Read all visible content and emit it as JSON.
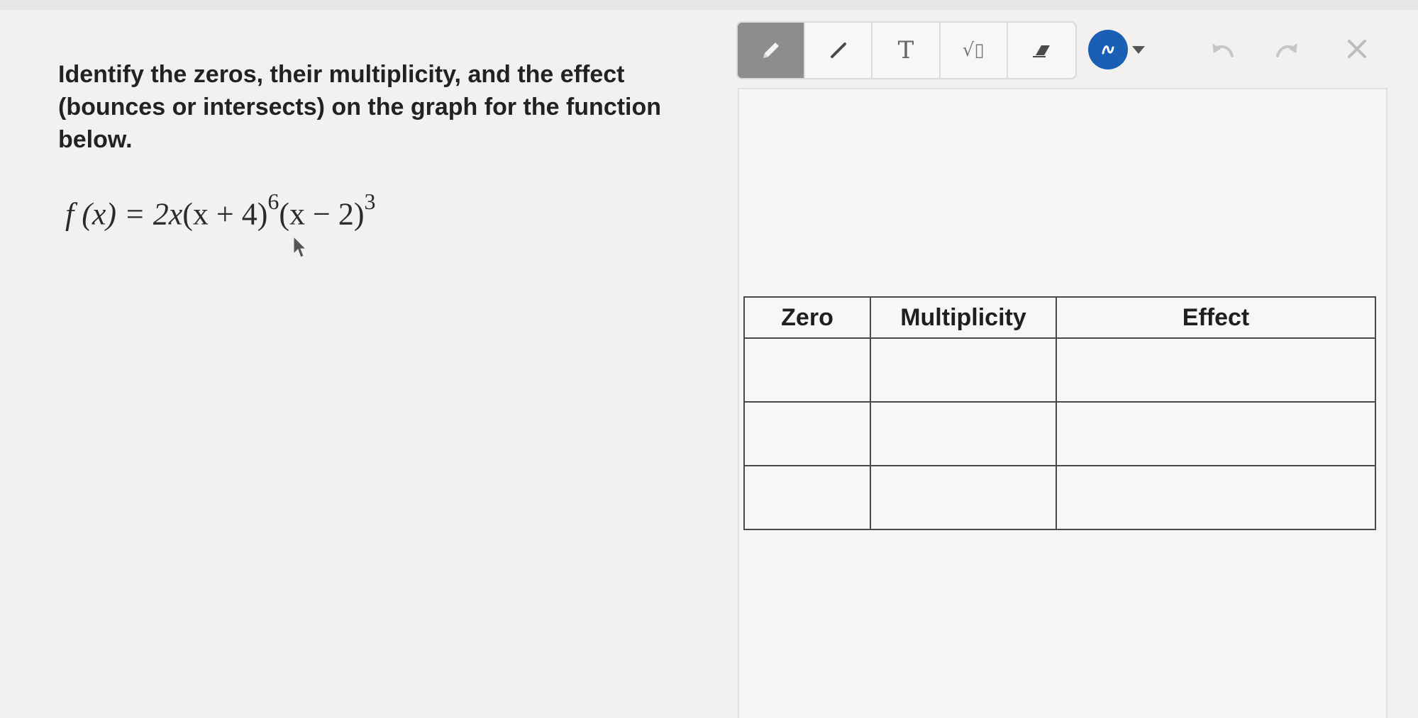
{
  "question": {
    "prompt": "Identify the zeros, their multiplicity, and the effect (bounces or intersects) on the graph for the function below.",
    "equation": {
      "lhs": "f (x) = ",
      "coef": "2x",
      "factor1": "(x + 4)",
      "exp1": "6",
      "factor2": "(x − 2)",
      "exp2": "3"
    }
  },
  "toolbar": {
    "tools": [
      {
        "name": "pencil-tool",
        "icon": "pencil-icon",
        "active": true
      },
      {
        "name": "line-tool",
        "icon": "line-icon",
        "active": false
      },
      {
        "name": "text-tool",
        "icon": "text-icon",
        "label": "T",
        "active": false
      },
      {
        "name": "math-tool",
        "icon": "sqrt-icon",
        "label": "√▯",
        "active": false
      },
      {
        "name": "eraser-tool",
        "icon": "eraser-icon",
        "active": false
      }
    ],
    "color": "#1a5fb4",
    "undo_icon": "undo-icon",
    "redo_icon": "redo-icon",
    "close_icon": "close-icon"
  },
  "table": {
    "headers": [
      "Zero",
      "Multiplicity",
      "Effect"
    ],
    "rows": [
      [
        "",
        "",
        ""
      ],
      [
        "",
        "",
        ""
      ],
      [
        "",
        "",
        ""
      ]
    ]
  }
}
